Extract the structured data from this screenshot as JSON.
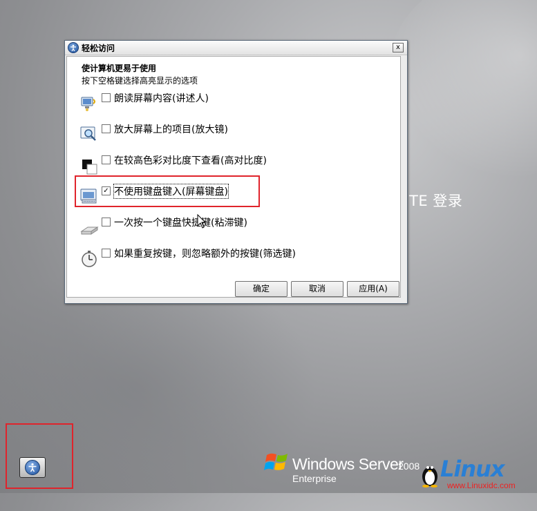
{
  "background": {
    "login_text": "TE 登录"
  },
  "dialog": {
    "title": "轻松访问",
    "close_label": "x",
    "heading": "使计算机更易于使用",
    "subheading": "按下空格键选择高亮显示的选项",
    "options": [
      {
        "label": "朗读屏幕内容(讲述人)",
        "checked": false,
        "icon": "narrator-icon",
        "check_mark": ""
      },
      {
        "label": "放大屏幕上的项目(放大镜)",
        "checked": false,
        "icon": "magnifier-icon",
        "check_mark": ""
      },
      {
        "label": "在较高色彩对比度下查看(高对比度)",
        "checked": false,
        "icon": "high-contrast-icon",
        "check_mark": ""
      },
      {
        "label": "不使用键盘键入(屏幕键盘)",
        "checked": true,
        "icon": "on-screen-keyboard-icon",
        "check_mark": "✓"
      },
      {
        "label": "一次按一个键盘快捷键(粘滞键)",
        "checked": false,
        "icon": "sticky-keys-icon",
        "check_mark": ""
      },
      {
        "label": "如果重复按键，则忽略额外的按键(筛选键)",
        "checked": false,
        "icon": "filter-keys-icon",
        "check_mark": ""
      }
    ],
    "buttons": {
      "ok": "确定",
      "cancel": "取消",
      "apply": "应用(A)"
    }
  },
  "branding": {
    "product": "Windows Server",
    "year": "2008",
    "edition": "Enterprise"
  },
  "watermark": {
    "brand": "Linux",
    "site": "www.Linuxidc.com"
  },
  "colors": {
    "highlight": "#e0232b",
    "accent": "#1b4e9b"
  }
}
